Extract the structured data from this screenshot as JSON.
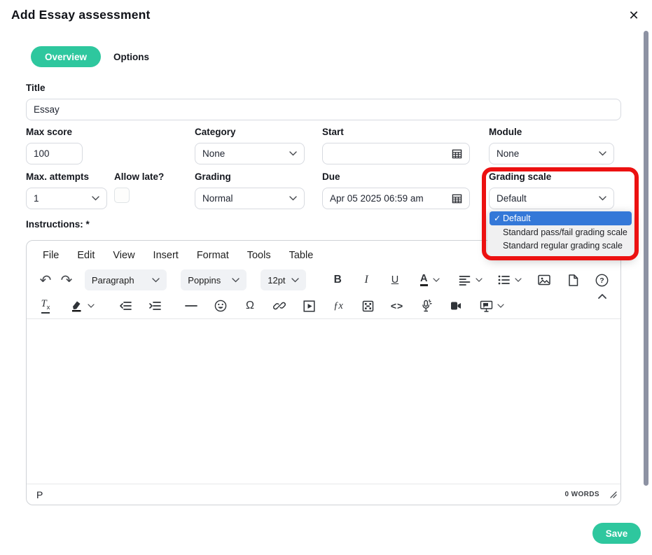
{
  "modal": {
    "title": "Add Essay assessment"
  },
  "tabs": [
    {
      "label": "Overview",
      "active": true
    },
    {
      "label": "Options",
      "active": false
    }
  ],
  "fields": {
    "title": {
      "label": "Title",
      "value": "Essay"
    },
    "max_score": {
      "label": "Max score",
      "value": "100"
    },
    "category": {
      "label": "Category",
      "value": "None"
    },
    "start": {
      "label": "Start",
      "value": ""
    },
    "module": {
      "label": "Module",
      "value": "None"
    },
    "max_attempts": {
      "label": "Max. attempts",
      "value": "1"
    },
    "allow_late": {
      "label": "Allow late?",
      "checked": false
    },
    "grading": {
      "label": "Grading",
      "value": "Normal"
    },
    "due": {
      "label": "Due",
      "value": "Apr 05 2025 06:59 am"
    },
    "grading_scale": {
      "label": "Grading scale",
      "value": "Default",
      "options": [
        "Default",
        "Standard pass/fail grading scale",
        "Standard regular grading scale"
      ],
      "selected_index": 0
    }
  },
  "instructions_label": "Instructions: *",
  "editor": {
    "menu": [
      "File",
      "Edit",
      "View",
      "Insert",
      "Format",
      "Tools",
      "Table"
    ],
    "paragraph_style": "Paragraph",
    "font_name": "Poppins",
    "font_size": "12pt",
    "status": {
      "element_path": "P",
      "word_count": "0 WORDS"
    }
  },
  "buttons": {
    "save": "Save"
  },
  "icons": {
    "close": "✕",
    "check": "✓",
    "undo": "↶",
    "redo": "↷",
    "bold": "B",
    "italic": "I",
    "underline": "U",
    "forecolor": "A",
    "omega": "Ω",
    "code": "<>",
    "fx": "ƒx",
    "removeformat_t": "T",
    "removeformat_x": "x"
  },
  "colors": {
    "accent_green": "#2ec79e",
    "annotation_red": "#ec1111",
    "selected_option_blue": "#3478d8",
    "scrollbar_gray": "#8d92a3"
  }
}
